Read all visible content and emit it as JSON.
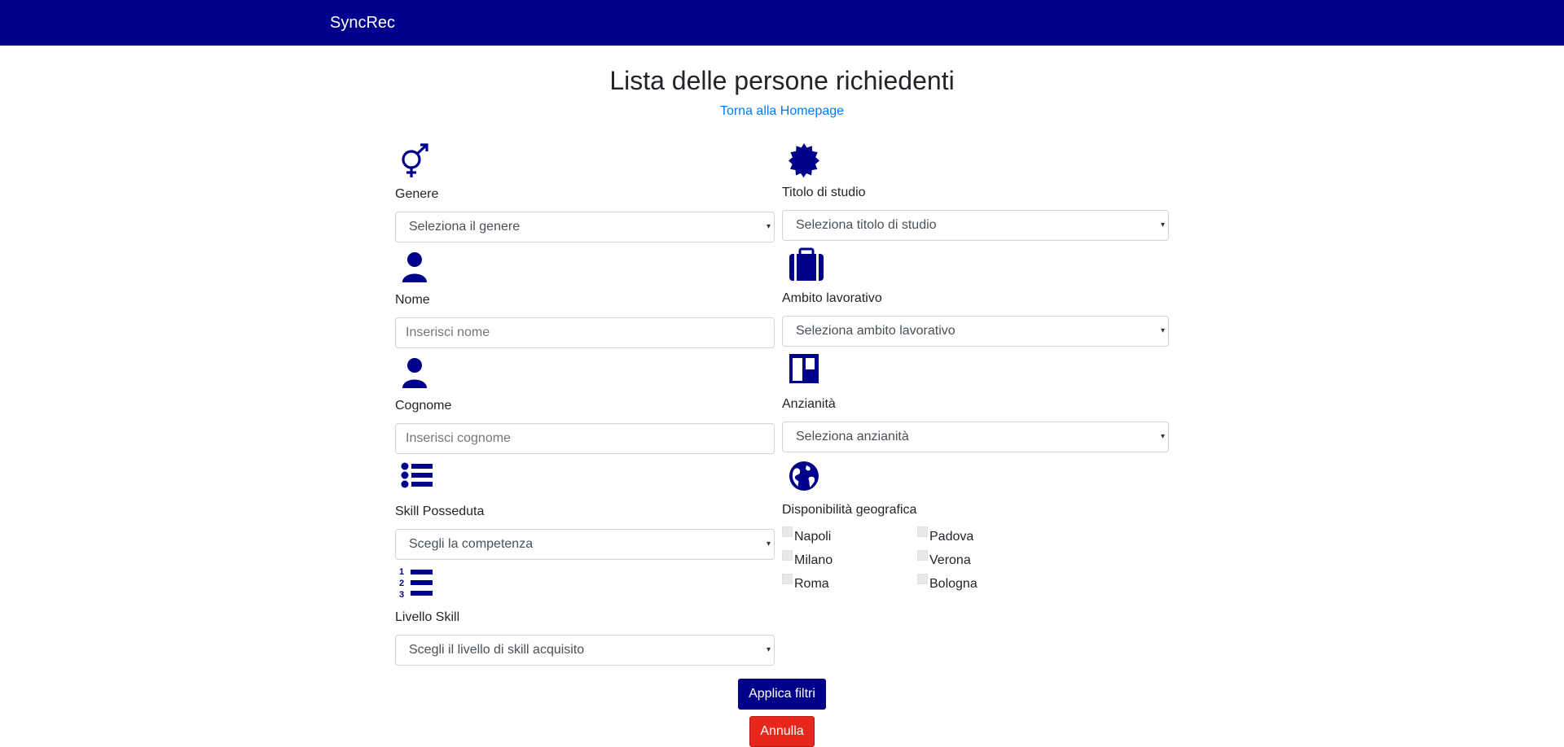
{
  "navbar": {
    "brand": "SyncRec"
  },
  "page": {
    "title": "Lista delle persone richiedenti",
    "home_link": "Torna alla Homepage"
  },
  "left_filters": {
    "genere": {
      "label": "Genere",
      "value": "Seleziona il genere",
      "icon": "gender-icon"
    },
    "nome": {
      "label": "Nome",
      "placeholder": "Inserisci nome",
      "icon": "user-icon"
    },
    "cognome": {
      "label": "Cognome",
      "placeholder": "Inserisci cognome",
      "icon": "user-icon"
    },
    "skill": {
      "label": "Skill Posseduta",
      "value": "Scegli la competenza",
      "icon": "list-icon"
    },
    "livello": {
      "label": "Livello Skill",
      "value": "Scegli il livello di skill acquisito",
      "icon": "ordered-list-icon"
    }
  },
  "right_filters": {
    "titolo": {
      "label": "Titolo di studio",
      "value": "Seleziona titolo di studio",
      "icon": "badge-icon"
    },
    "ambito": {
      "label": "Ambito lavorativo",
      "value": "Seleziona ambito lavorativo",
      "icon": "briefcase-icon"
    },
    "anzianita": {
      "label": "Anzianità",
      "value": "Seleziona anzianità",
      "icon": "trello-icon"
    },
    "geo": {
      "label": "Disponibilità geografica",
      "icon": "globe-icon",
      "cities_col1": [
        "Napoli",
        "Milano",
        "Roma"
      ],
      "cities_col2": [
        "Padova",
        "Verona",
        "Bologna"
      ]
    }
  },
  "buttons": {
    "apply": "Applica filtri",
    "cancel": "Annulla"
  },
  "colors": {
    "primary": "#00008b",
    "danger": "#e8271c",
    "link": "#007bff"
  }
}
